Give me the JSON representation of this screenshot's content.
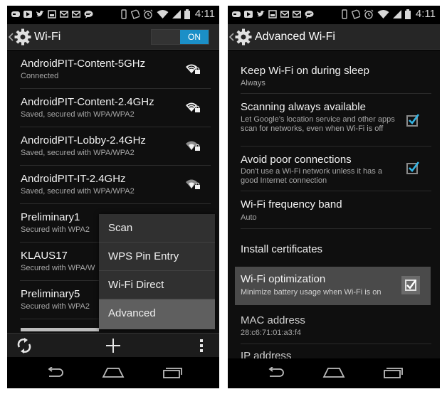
{
  "status_bar": {
    "time": "4:11"
  },
  "left_screen": {
    "title": "Wi-Fi",
    "switch_label": "ON",
    "networks": [
      {
        "name": "AndroidPIT-Content-5GHz",
        "status": "Connected"
      },
      {
        "name": "AndroidPIT-Content-2.4GHz",
        "status": "Saved, secured with WPA/WPA2"
      },
      {
        "name": "AndroidPIT-Lobby-2.4GHz",
        "status": "Saved, secured with WPA/WPA2"
      },
      {
        "name": "AndroidPIT-IT-2.4GHz",
        "status": "Saved, secured with WPA/WPA2"
      },
      {
        "name": "Preliminary1",
        "status": "Secured with WPA2"
      },
      {
        "name": "KLAUS17",
        "status": "Secured with WPA/W"
      },
      {
        "name": "Preliminary5",
        "status": "Secured with WPA2"
      }
    ],
    "menu": [
      "Scan",
      "WPS Pin Entry",
      "Wi-Fi Direct",
      "Advanced"
    ],
    "menu_selected": "Advanced"
  },
  "right_screen": {
    "title": "Advanced Wi-Fi",
    "settings": [
      {
        "title": "Keep Wi-Fi on during sleep",
        "subtitle": "Always"
      },
      {
        "title": "Scanning always available",
        "subtitle": "Let Google's location service and other apps scan for networks, even when Wi-Fi is off",
        "checked": true
      },
      {
        "title": "Avoid poor connections",
        "subtitle": "Don't use a Wi-Fi network unless it has a good Internet connection",
        "checked": true
      },
      {
        "title": "Wi-Fi frequency band",
        "subtitle": "Auto"
      },
      {
        "title": "Install certificates",
        "subtitle": ""
      },
      {
        "title": "Wi-Fi optimization",
        "subtitle": "Minimize battery usage when Wi-Fi is on",
        "checked": true
      },
      {
        "title": "MAC address",
        "subtitle": "28:c6:71:01:a3:f4"
      },
      {
        "title": "IP address",
        "subtitle": ""
      }
    ]
  },
  "colors": {
    "accent": "#1b8fc7",
    "check": "#33b5e5"
  }
}
